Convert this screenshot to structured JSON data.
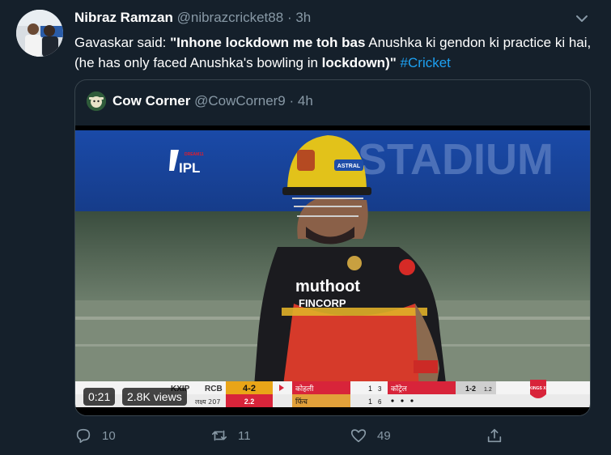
{
  "tweet": {
    "author_name": "Nibraz Ramzan",
    "author_handle": "@nibrazcricket88",
    "separator": "·",
    "time": "3h",
    "text": {
      "p1": "Gavaskar said: ",
      "p2": "\"Inhone lockdown me toh bas",
      "p3": " Anushka ki gendon ki practice ki hai, (he has only faced Anushka's bowling in ",
      "p4": "lockdown",
      "p5": ")\"",
      "p6": " ",
      "hashtag": "#Cricket"
    }
  },
  "quoted": {
    "author_name": "Cow Corner",
    "author_handle": "@CowCorner9",
    "separator": "·",
    "time": "4h"
  },
  "video": {
    "duration": "0:21",
    "views": "2.8K views",
    "logo_text": "IPL",
    "logo_small": "DREAM11",
    "helmet_sponsor": "ASTRAL",
    "jersey_sponsor": "muthoot",
    "jersey_sub": "FINCORP",
    "stadium_text": "STADIUM",
    "score": {
      "team1": "KXIP",
      "team2": "RCB",
      "score": "4-2",
      "over": "2.2",
      "target_label": "लक्ष्य 207",
      "batsman1": "कोहली",
      "b1_runs": "1",
      "b1_balls": "3",
      "batsman2": "फिंच",
      "b2_runs": "1",
      "b2_balls": "6",
      "bowler": "कॉट्रेल",
      "bowler_figures": "1-2",
      "bowler_overs": "1.2",
      "kings_xi": "KINGS XI"
    }
  },
  "actions": {
    "replies": "10",
    "retweets": "11",
    "likes": "49"
  },
  "colors": {
    "background": "#15202b",
    "muted": "#8899a6",
    "link": "#1da1f2",
    "border": "#38444d"
  }
}
